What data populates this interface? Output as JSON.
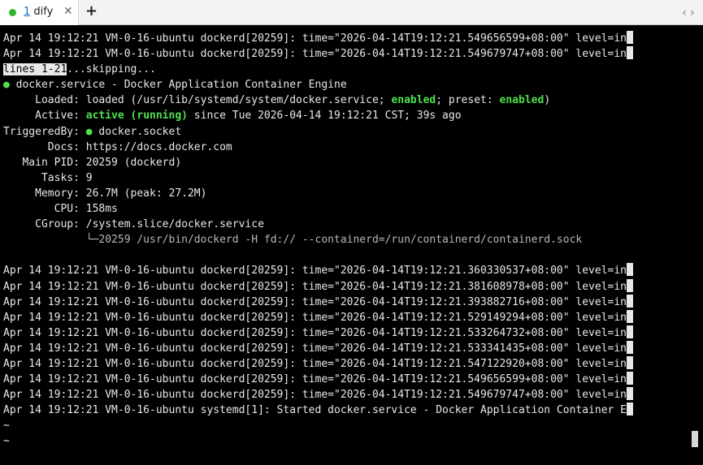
{
  "tab": {
    "number": "1",
    "title": "dify",
    "close": "✕",
    "new": "+",
    "prev": "‹",
    "next": "›"
  },
  "colors": {
    "status_green": "#4ee04e",
    "tab_dot": "#2db52d"
  },
  "terminal": {
    "top_lines": [
      "Apr 14 19:12:21 VM-0-16-ubuntu dockerd[20259]: time=\"2026-04-14T19:12:21.549656599+08:00\" level=in",
      "Apr 14 19:12:21 VM-0-16-ubuntu dockerd[20259]: time=\"2026-04-14T19:12:21.549679747+08:00\" level=in"
    ],
    "pager_hl": "lines 1-21",
    "pager_rest": "...skipping...",
    "service_dot": "●",
    "service_name": " docker.service - Docker Application Container Engine",
    "loaded_label": "     Loaded: ",
    "loaded_text_1": "loaded (/usr/lib/systemd/system/docker.service; ",
    "loaded_enabled": "enabled",
    "loaded_text_2": "; preset: ",
    "loaded_preset": "enabled",
    "loaded_text_3": ")",
    "active_label": "     Active: ",
    "active_status": "active (running)",
    "active_since": " since Tue 2026-04-14 19:12:21 CST; 39s ago",
    "triggered_label": "TriggeredBy: ",
    "triggered_dot": "●",
    "triggered_value": " docker.socket",
    "docs": "       Docs: https://docs.docker.com",
    "mainpid": "   Main PID: 20259 (dockerd)",
    "tasks": "      Tasks: 9",
    "memory": "     Memory: 26.7M (peak: 27.2M)",
    "cpu": "        CPU: 158ms",
    "cgroup": "     CGroup: /system.slice/docker.service",
    "cgroup_child": "             └─20259 /usr/bin/dockerd -H fd:// --containerd=/run/containerd/containerd.sock",
    "log_lines": [
      "Apr 14 19:12:21 VM-0-16-ubuntu dockerd[20259]: time=\"2026-04-14T19:12:21.360330537+08:00\" level=in",
      "Apr 14 19:12:21 VM-0-16-ubuntu dockerd[20259]: time=\"2026-04-14T19:12:21.381608978+08:00\" level=in",
      "Apr 14 19:12:21 VM-0-16-ubuntu dockerd[20259]: time=\"2026-04-14T19:12:21.393882716+08:00\" level=in",
      "Apr 14 19:12:21 VM-0-16-ubuntu dockerd[20259]: time=\"2026-04-14T19:12:21.529149294+08:00\" level=in",
      "Apr 14 19:12:21 VM-0-16-ubuntu dockerd[20259]: time=\"2026-04-14T19:12:21.533264732+08:00\" level=in",
      "Apr 14 19:12:21 VM-0-16-ubuntu dockerd[20259]: time=\"2026-04-14T19:12:21.533341435+08:00\" level=in",
      "Apr 14 19:12:21 VM-0-16-ubuntu dockerd[20259]: time=\"2026-04-14T19:12:21.547122920+08:00\" level=in",
      "Apr 14 19:12:21 VM-0-16-ubuntu dockerd[20259]: time=\"2026-04-14T19:12:21.549656599+08:00\" level=in",
      "Apr 14 19:12:21 VM-0-16-ubuntu dockerd[20259]: time=\"2026-04-14T19:12:21.549679747+08:00\" level=in",
      "Apr 14 19:12:21 VM-0-16-ubuntu systemd[1]: Started docker.service - Docker Application Container E"
    ],
    "tilde_1": "~",
    "tilde_2": "~"
  }
}
